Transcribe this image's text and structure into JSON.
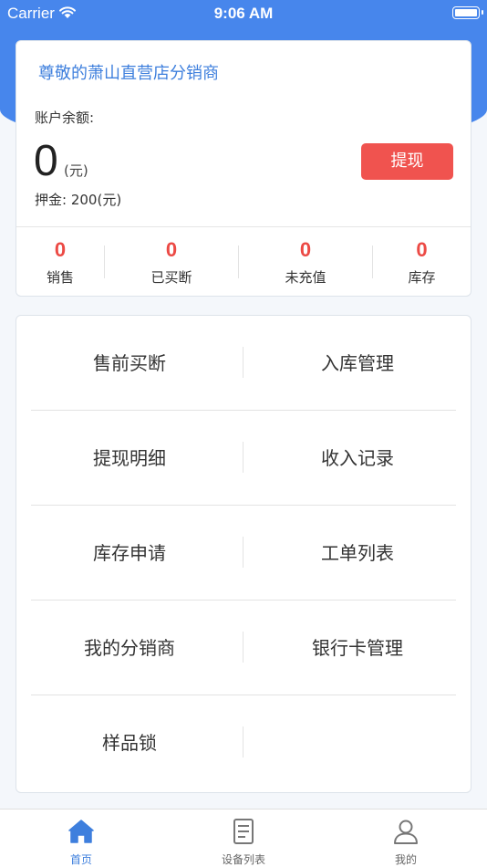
{
  "status_bar": {
    "carrier": "Carrier",
    "time": "9:06 AM"
  },
  "account": {
    "store_name": "尊敬的萧山直营店分销商",
    "balance_label": "账户余额:",
    "balance_amount": "0",
    "balance_unit": "(元)",
    "withdraw_label": "提现",
    "deposit_label": "押金:",
    "deposit_value": "200(元)"
  },
  "stats": [
    {
      "value": "0",
      "label": "销售"
    },
    {
      "value": "0",
      "label": "已买断"
    },
    {
      "value": "0",
      "label": "未充值"
    },
    {
      "value": "0",
      "label": "库存"
    }
  ],
  "menu": [
    {
      "left": "售前买断",
      "right": "入库管理"
    },
    {
      "left": "提现明细",
      "right": "收入记录"
    },
    {
      "left": "库存申请",
      "right": "工单列表"
    },
    {
      "left": "我的分销商",
      "right": "银行卡管理"
    },
    {
      "left": "样品锁",
      "right": ""
    }
  ],
  "tabs": [
    {
      "label": "首页",
      "icon": "home-icon",
      "active": true
    },
    {
      "label": "设备列表",
      "icon": "document-list-icon",
      "active": false
    },
    {
      "label": "我的",
      "icon": "user-icon",
      "active": false
    }
  ],
  "colors": {
    "brand_blue": "#4786ec",
    "accent_red": "#f0534f",
    "stat_red": "#ec4a45",
    "link_blue": "#3e7fdd"
  }
}
